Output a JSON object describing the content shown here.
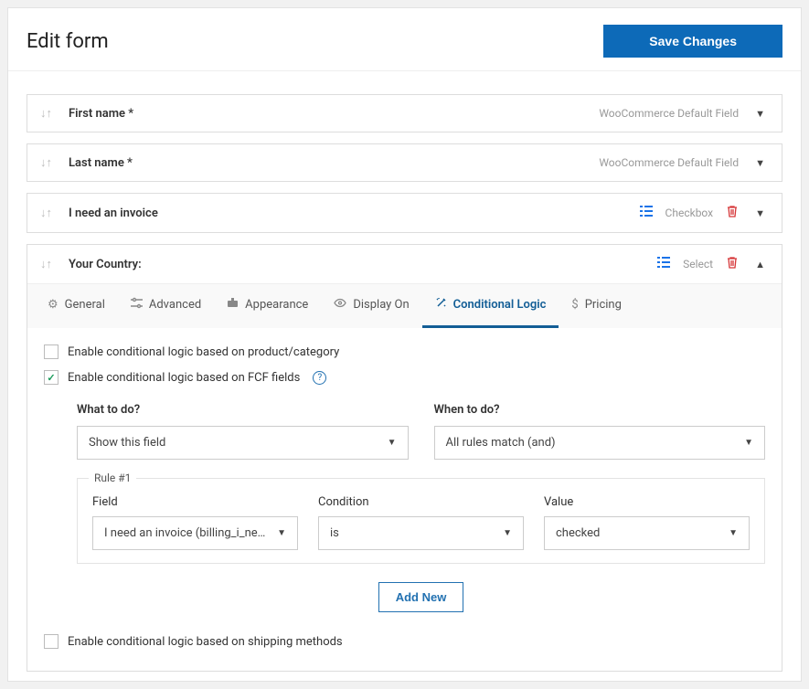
{
  "header": {
    "title": "Edit form",
    "save_label": "Save Changes"
  },
  "fields": [
    {
      "name": "First name *",
      "type_label": "WooCommerce Default Field",
      "type_icon": "",
      "trash": false
    },
    {
      "name": "Last name *",
      "type_label": "WooCommerce Default Field",
      "type_icon": "",
      "trash": false
    },
    {
      "name": "I need an invoice",
      "type_label": "Checkbox",
      "type_icon": "list",
      "trash": true
    },
    {
      "name": "Your Country:",
      "type_label": "Select",
      "type_icon": "list",
      "trash": true
    }
  ],
  "tabs": {
    "general": "General",
    "advanced": "Advanced",
    "appearance": "Appearance",
    "display_on": "Display On",
    "conditional": "Conditional Logic",
    "pricing": "Pricing"
  },
  "panel": {
    "enable_product": "Enable conditional logic based on product/category",
    "enable_fcf": "Enable conditional logic based on FCF fields",
    "what_label": "What to do?",
    "what_value": "Show this field",
    "when_label": "When to do?",
    "when_value": "All rules match (and)",
    "rule_title": "Rule #1",
    "rule_field_label": "Field",
    "rule_field_value": "I need an invoice (billing_i_need_a...",
    "rule_cond_label": "Condition",
    "rule_cond_value": "is",
    "rule_value_label": "Value",
    "rule_value_value": "checked",
    "add_new": "Add New",
    "enable_shipping": "Enable conditional logic based on shipping methods"
  }
}
